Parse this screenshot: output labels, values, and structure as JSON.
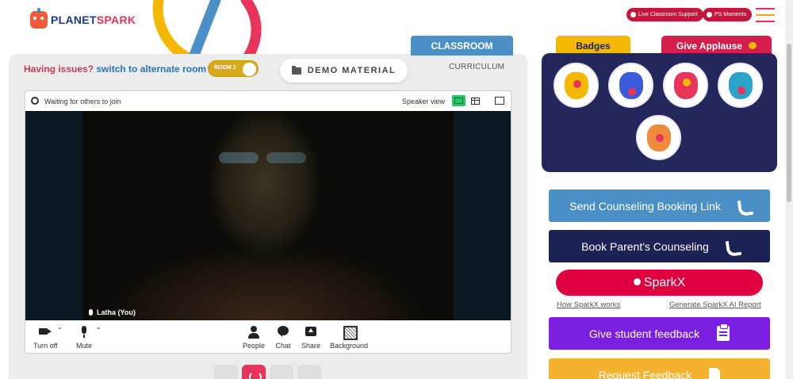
{
  "header": {
    "logo_part1": "PLANET",
    "logo_part2": "SPARK",
    "live_support_label": "Live Classroom Support",
    "ps_moments_label": "PS Moments"
  },
  "classroom": {
    "issues_question": "Having issues?",
    "issues_action": "switch to alternate room",
    "room_toggle_label": "ROOM 2",
    "demo_material_label": "DEMO MATERIAL",
    "tab_classroom": "CLASSROOM",
    "tab_curriculum": "CURRICULUM"
  },
  "video": {
    "status_text": "Waiting for others to join",
    "view_label": "Speaker view",
    "participant_name": "Latha (You)",
    "controls": [
      {
        "id": "turn-off",
        "label": "Turn off"
      },
      {
        "id": "mute",
        "label": "Mute"
      },
      {
        "id": "people",
        "label": "People"
      },
      {
        "id": "chat",
        "label": "Chat"
      },
      {
        "id": "share",
        "label": "Share"
      },
      {
        "id": "background",
        "label": "Background"
      }
    ]
  },
  "right": {
    "tab_badges": "Badges",
    "tab_applause": "Give Applause",
    "badges": [
      "trophy-badge",
      "fist-badge",
      "leader-badge",
      "idea-badge",
      "robot-badge"
    ],
    "buttons": {
      "send_counseling": "Send Counseling Booking Link",
      "book_counseling": "Book Parent's Counseling",
      "sparkx": "SparkX",
      "how_sparkx": "How SparkX works",
      "generate_report": "Generate SparkX AI Report",
      "student_feedback": "Give student feedback",
      "request_feedback": "Request Feedback"
    }
  },
  "colors": {
    "brand_red": "#e0003f",
    "brand_blue": "#4a8fc6",
    "navy": "#24275b",
    "purple": "#7a1fe0",
    "amber": "#f5b800"
  }
}
